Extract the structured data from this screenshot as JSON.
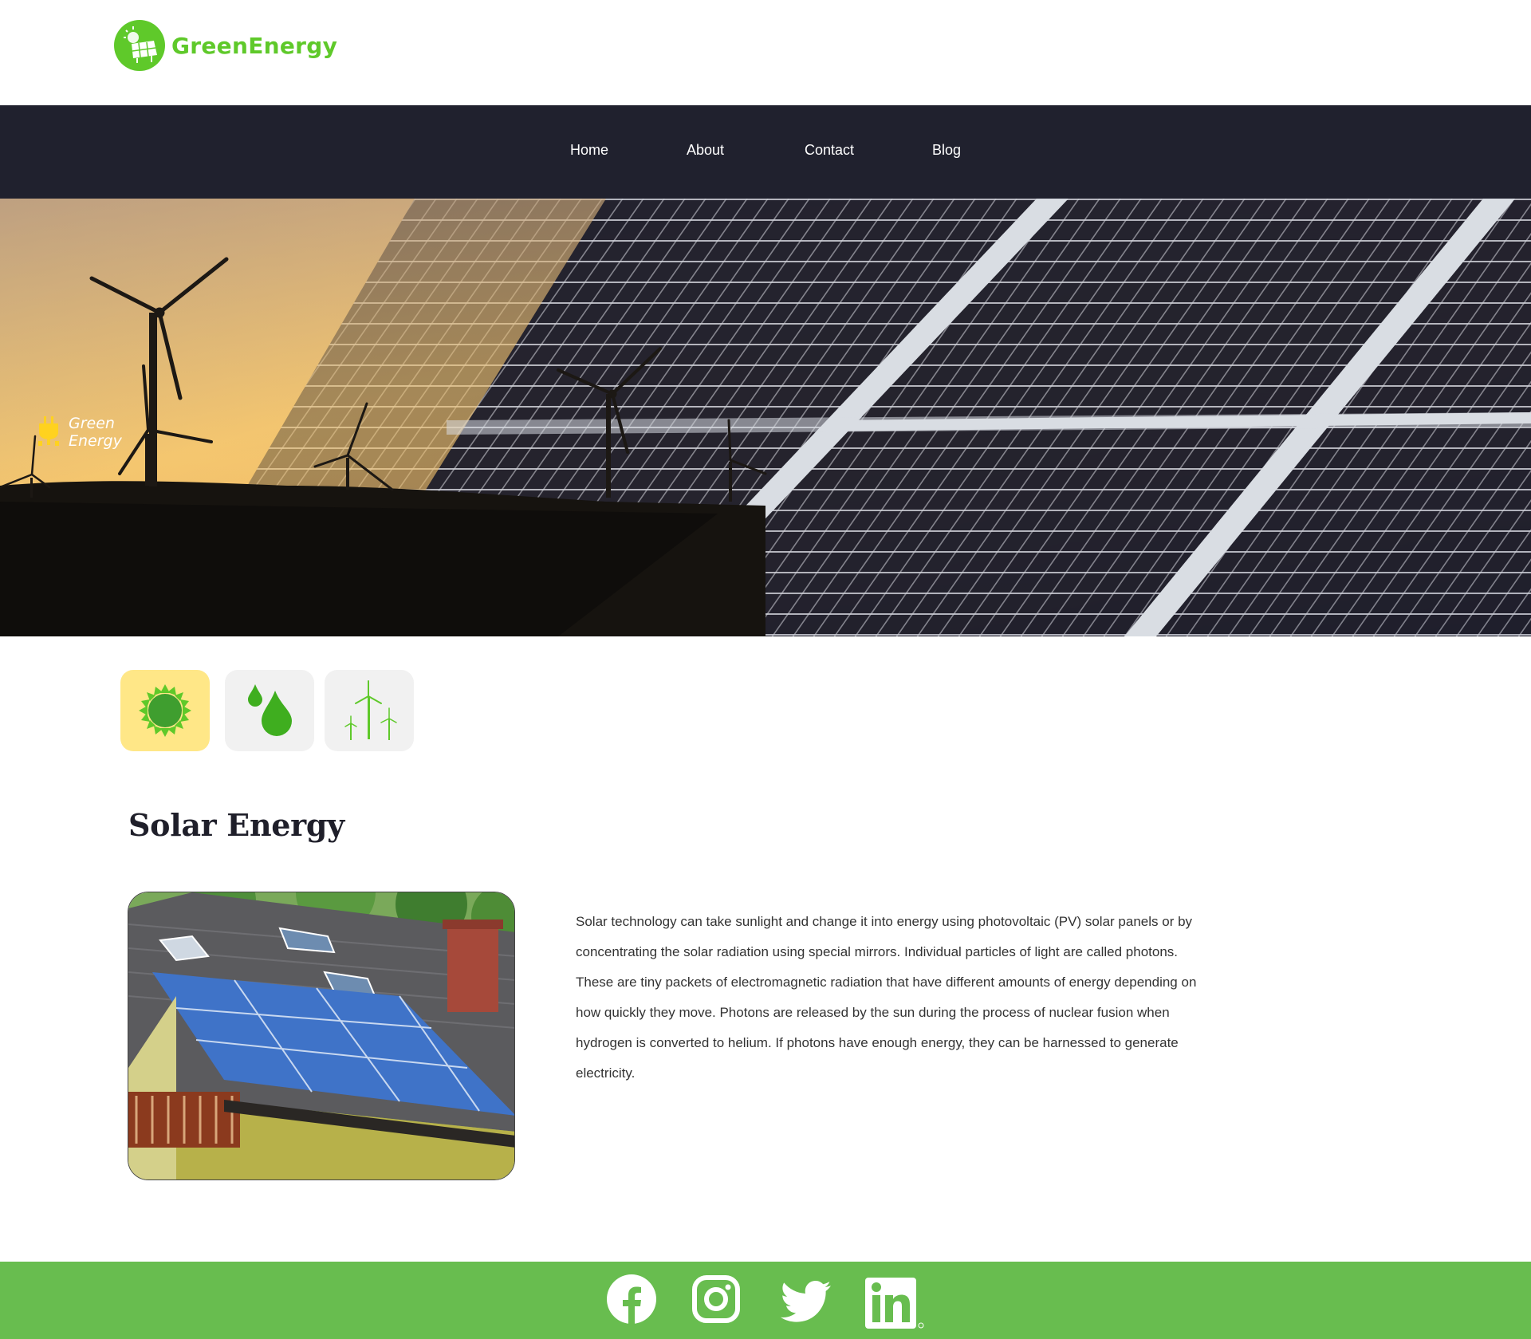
{
  "brand": {
    "name": "GreenEnergy",
    "accent": "#5fc92a"
  },
  "nav": {
    "items": [
      {
        "label": "Home"
      },
      {
        "label": "About"
      },
      {
        "label": "Contact"
      },
      {
        "label": "Blog"
      }
    ],
    "background": "#20212e"
  },
  "hero": {
    "badge_line1": "Green",
    "badge_line2": "Energy",
    "badge_icon": "plug-icon"
  },
  "categories": [
    {
      "icon": "sun-icon",
      "selected": true
    },
    {
      "icon": "water-drops-icon",
      "selected": false
    },
    {
      "icon": "wind-turbines-icon",
      "selected": false
    }
  ],
  "section": {
    "title": "Solar Energy",
    "body": "Solar technology can take sunlight and change it into energy using photovoltaic (PV) solar panels or by concentrating the solar radiation using special mirrors. Individual particles of light are called photons. These are tiny packets of electromagnetic radiation that have different amounts of energy depending on how quickly they move. Photons are released by the sun during the process of nuclear fusion when hydrogen is converted to helium. If photons have enough energy, they can be harnessed to generate electricity."
  },
  "footer": {
    "background": "#68bd4f",
    "social": [
      {
        "icon": "facebook-icon"
      },
      {
        "icon": "instagram-icon"
      },
      {
        "icon": "twitter-icon"
      },
      {
        "icon": "linkedin-icon"
      }
    ]
  }
}
